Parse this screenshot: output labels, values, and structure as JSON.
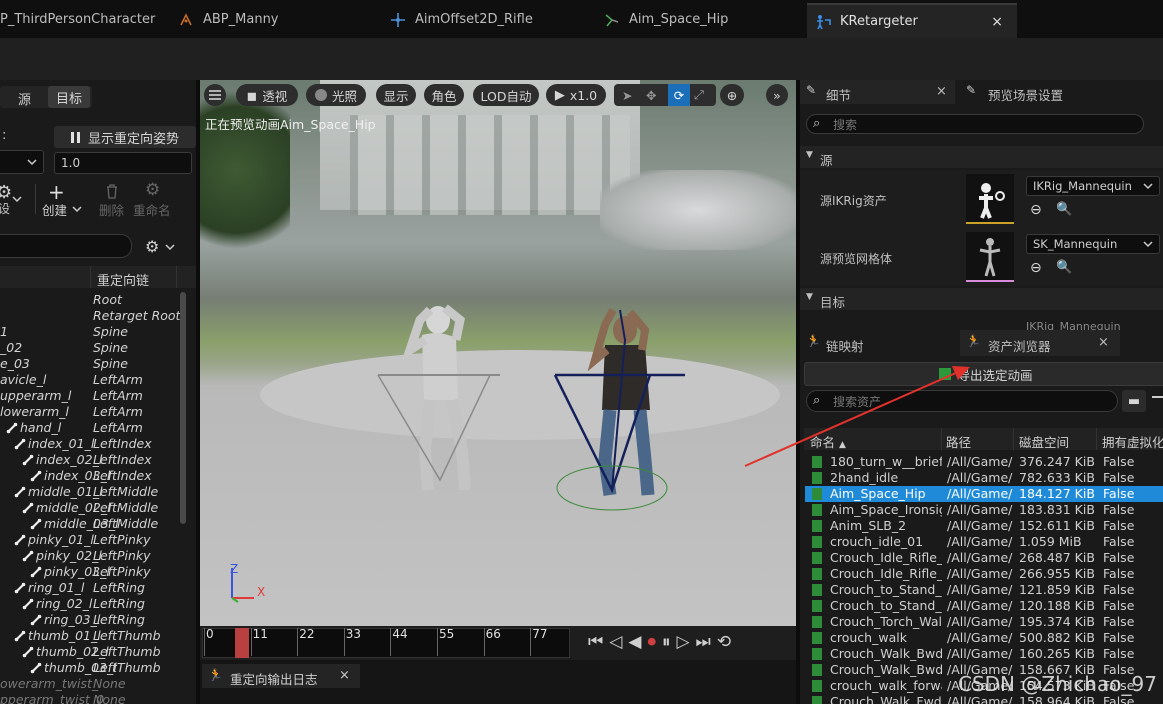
{
  "tabs": [
    {
      "label": "P_ThirdPersonCharacter",
      "icon": "blueprint-icon"
    },
    {
      "label": "ABP_Manny",
      "icon": "anim-blueprint-icon"
    },
    {
      "label": "AimOffset2D_Rifle",
      "icon": "aim-offset-icon"
    },
    {
      "label": "Aim_Space_Hip",
      "icon": "anim-sequence-icon"
    },
    {
      "label": "KRetargeter",
      "icon": "retargeter-icon",
      "close": "×"
    }
  ],
  "left": {
    "source_label": "源",
    "target_label": "目标",
    "colon": ":",
    "show_pose_label": "显示重定向姿势",
    "offset_value": "1.0",
    "create_label": "创建",
    "delete_label": "删除",
    "rename_label": "重命名",
    "partial_label": "设",
    "col_chain": "重定向链",
    "rows": [
      {
        "bone": "",
        "chain": "Root"
      },
      {
        "bone": "",
        "chain": "Retarget Root"
      },
      {
        "bone": "1",
        "chain": "Spine"
      },
      {
        "bone": "_02",
        "chain": "Spine"
      },
      {
        "bone": "e_03",
        "chain": "Spine"
      },
      {
        "bone": "avicle_l",
        "chain": "LeftArm"
      },
      {
        "bone": "upperarm_l",
        "chain": "LeftArm"
      },
      {
        "bone": "lowerarm_l",
        "chain": "LeftArm"
      },
      {
        "bone": "hand_l",
        "chain": "LeftArm"
      },
      {
        "bone": "index_01_l",
        "chain": "LeftIndex"
      },
      {
        "bone": "index_02_l",
        "chain": "LeftIndex"
      },
      {
        "bone": "index_03_l",
        "chain": "LeftIndex"
      },
      {
        "bone": "middle_01_l",
        "chain": "LeftMiddle"
      },
      {
        "bone": "middle_02_l",
        "chain": "LeftMiddle"
      },
      {
        "bone": "middle_03_l",
        "chain": "LeftMiddle"
      },
      {
        "bone": "pinky_01_l",
        "chain": "LeftPinky"
      },
      {
        "bone": "pinky_02_l",
        "chain": "LeftPinky"
      },
      {
        "bone": "pinky_03_l",
        "chain": "LeftPinky"
      },
      {
        "bone": "ring_01_l",
        "chain": "LeftRing"
      },
      {
        "bone": "ring_02_l",
        "chain": "LeftRing"
      },
      {
        "bone": "ring_03_l",
        "chain": "LeftRing"
      },
      {
        "bone": "thumb_01_l",
        "chain": "LeftThumb"
      },
      {
        "bone": "thumb_02_l",
        "chain": "LeftThumb"
      },
      {
        "bone": "thumb_03_l",
        "chain": "LeftThumb"
      },
      {
        "bone": "owerarm_twist_",
        "chain": "None"
      },
      {
        "bone": "pperarm_twist_0",
        "chain": "None"
      }
    ]
  },
  "viewport": {
    "perspective": "透视",
    "lighting": "光照",
    "show": "显示",
    "character": "角色",
    "lod": "LOD自动",
    "speed": "x1.0",
    "preview_text": "正在预览动画Aim_Space_Hip",
    "axis_z": "Z",
    "axis_x": "X"
  },
  "timeline": {
    "ticks": [
      "0",
      "11",
      "22",
      "33",
      "44",
      "55",
      "66",
      "77"
    ],
    "log_tab": "重定向输出日志",
    "log_close": "×"
  },
  "details": {
    "tab_details": "细节",
    "tab_preview": "预览场景设置",
    "close": "×",
    "search_placeholder": "搜索",
    "section_source": "源",
    "source_ikrig_label": "源IKRig资产",
    "source_ikrig_value": "IKRig_Mannequin",
    "source_mesh_label": "源预览网格体",
    "source_mesh_value": "SK_Mannequin",
    "section_target": "目标",
    "target_partial": "IKRig_Mannequin"
  },
  "assets": {
    "tab_chain": "链映射",
    "tab_browser": "资产浏览器",
    "close": "×",
    "export_label": "导出选定动画",
    "search_placeholder": "搜索资产",
    "col_name": "命名",
    "col_path": "路径",
    "col_size": "磁盘空间",
    "col_virtual": "拥有虚拟化",
    "rows": [
      {
        "name": "180_turn_w__briefc",
        "path": "/All/Game/.",
        "size": "376.247 KiB",
        "flag": "False"
      },
      {
        "name": "2hand_idle",
        "path": "/All/Game/.",
        "size": "782.633 KiB",
        "flag": "False"
      },
      {
        "name": "Aim_Space_Hip",
        "path": "/All/Game/.",
        "size": "184.127 KiB",
        "flag": "False",
        "selected": true
      },
      {
        "name": "Aim_Space_Ironsigl",
        "path": "/All/Game/.",
        "size": "183.831 KiB",
        "flag": "False"
      },
      {
        "name": "Anim_SLB_2",
        "path": "/All/Game/.",
        "size": "152.611 KiB",
        "flag": "False"
      },
      {
        "name": "crouch_idle_01",
        "path": "/All/Game/.",
        "size": "1.059 MiB",
        "flag": "False"
      },
      {
        "name": "Crouch_Idle_Rifle_H",
        "path": "/All/Game/.",
        "size": "268.487 KiB",
        "flag": "False"
      },
      {
        "name": "Crouch_Idle_Rifle_Ir",
        "path": "/All/Game/.",
        "size": "266.955 KiB",
        "flag": "False"
      },
      {
        "name": "Crouch_to_Stand_R",
        "path": "/All/Game/.",
        "size": "121.859 KiB",
        "flag": "False"
      },
      {
        "name": "Crouch_to_Stand_R",
        "path": "/All/Game/.",
        "size": "120.188 KiB",
        "flag": "False"
      },
      {
        "name": "Crouch_Torch_Walk",
        "path": "/All/Game/.",
        "size": "195.374 KiB",
        "flag": "False"
      },
      {
        "name": "crouch_walk",
        "path": "/All/Game/.",
        "size": "500.882 KiB",
        "flag": "False"
      },
      {
        "name": "Crouch_Walk_Bwd_",
        "path": "/All/Game/.",
        "size": "160.265 KiB",
        "flag": "False"
      },
      {
        "name": "Crouch_Walk_Bwd_",
        "path": "/All/Game/.",
        "size": "158.667 KiB",
        "flag": "False"
      },
      {
        "name": "crouch_walk_forwa",
        "path": "/All/Game/.",
        "size": "154.573 KiB",
        "flag": "False"
      },
      {
        "name": "Crouch_Walk_Fwd_",
        "path": "/All/Game/.",
        "size": "158.964 KiB",
        "flag": "False"
      }
    ]
  },
  "watermark": "CSDN @Zhichao_97",
  "colors": {
    "selection": "#1f8bd8",
    "arrow": "#e0322a",
    "timeline_playhead": "#b84040"
  }
}
